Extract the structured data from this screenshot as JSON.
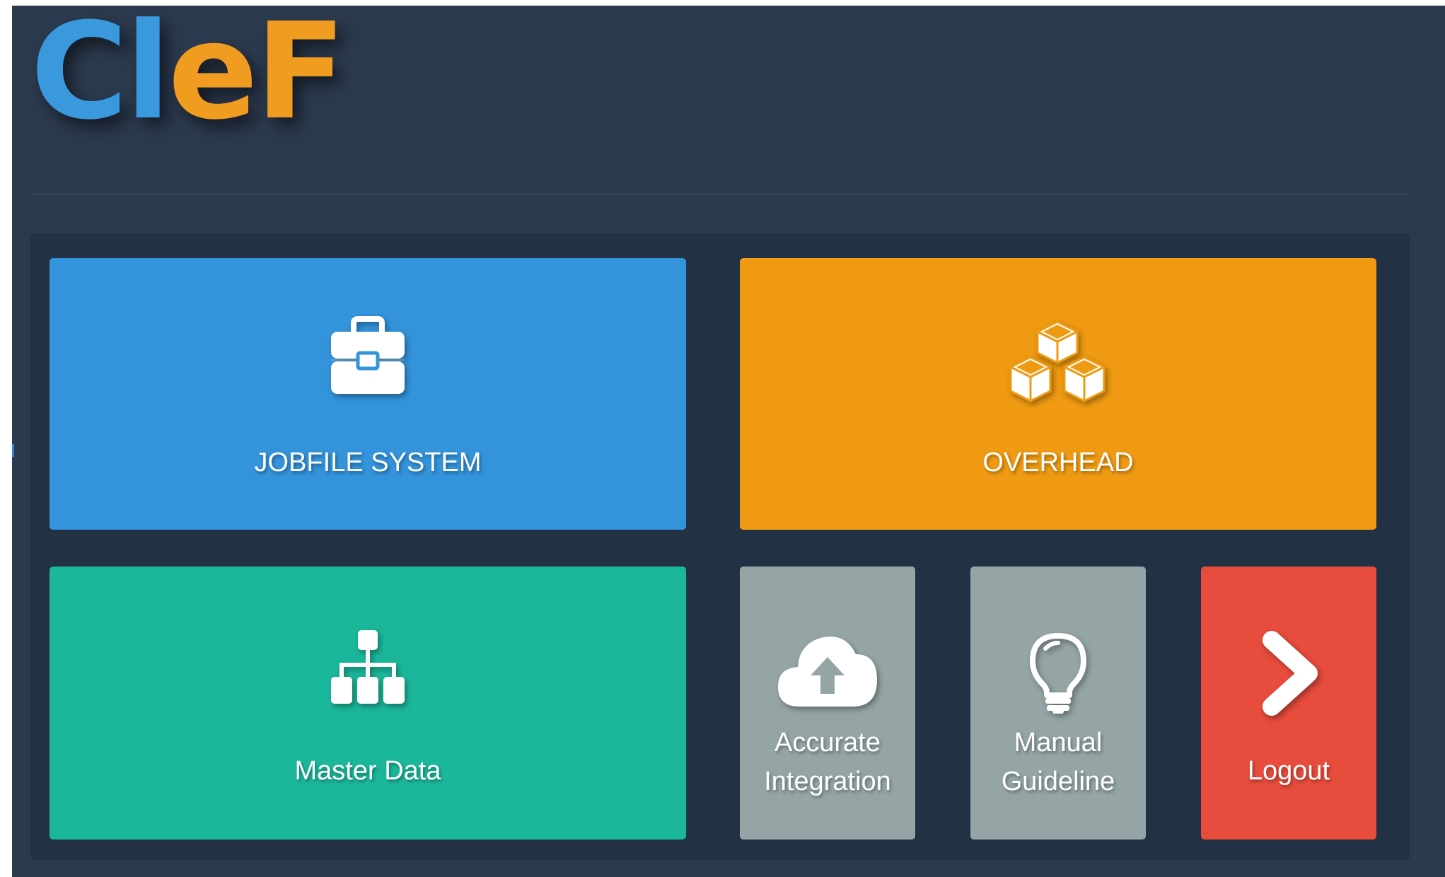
{
  "logo": {
    "part1": "Cl",
    "part2": "eF",
    "color1": "#3a98dc",
    "color2": "#f09c20"
  },
  "tiles": {
    "jobfile": {
      "label": "JOBFILE SYSTEM",
      "icon": "briefcase-icon",
      "color": "#3393db"
    },
    "overhead": {
      "label": "OVERHEAD",
      "icon": "cubes-icon",
      "color": "#ef9a12"
    },
    "master_data": {
      "label": "Master Data",
      "icon": "sitemap-icon",
      "color": "#1bb79b"
    },
    "accurate": {
      "line1": "Accurate",
      "line2": "Integration",
      "icon": "cloud-upload-icon",
      "color": "#95a5a6"
    },
    "manual": {
      "line1": "Manual",
      "line2": "Guideline",
      "icon": "lightbulb-icon",
      "color": "#95a5a6"
    },
    "logout": {
      "label": "Logout",
      "icon": "chevron-right-icon",
      "color": "#e74c3c"
    }
  }
}
